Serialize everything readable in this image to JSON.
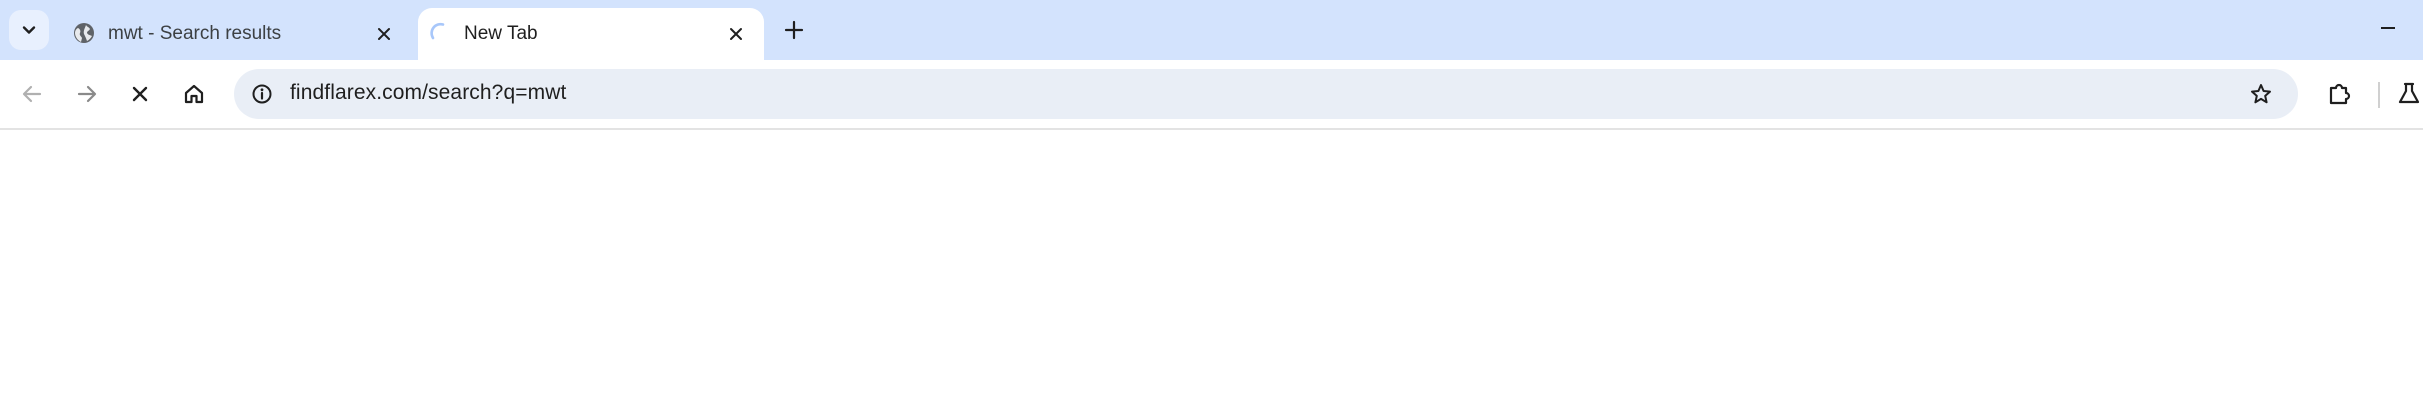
{
  "tabs": [
    {
      "title": "mwt - Search results",
      "favicon": "globe-icon",
      "active": false
    },
    {
      "title": "New Tab",
      "favicon": "loading-spinner-icon",
      "active": true
    }
  ],
  "omnibox": {
    "url": "findflarex.com/search?q=mwt",
    "info_icon": "info-icon"
  },
  "toolbar": {
    "back": "back-arrow-icon",
    "forward": "forward-arrow-icon",
    "stop": "stop-icon",
    "home": "home-icon",
    "bookmark": "star-icon",
    "extensions": "puzzle-icon",
    "labs": "flask-icon"
  },
  "colors": {
    "tabstrip": "#d3e3fd",
    "omnibox": "#e9eef6",
    "icon": "#474747"
  }
}
